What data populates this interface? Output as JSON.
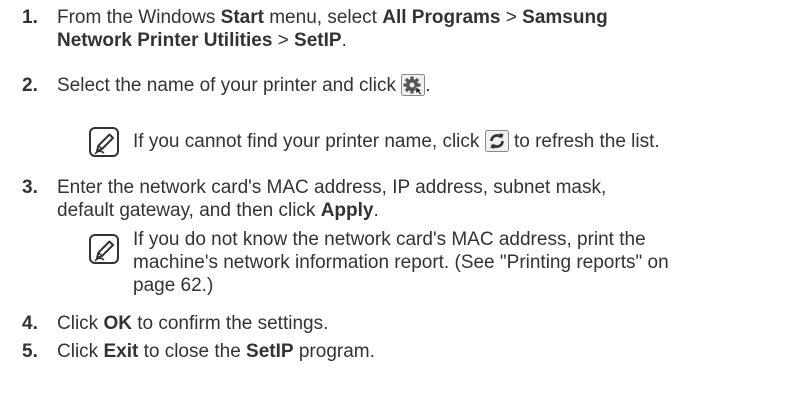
{
  "steps": [
    {
      "number": "1.",
      "line1": {
        "t1": "From the Windows ",
        "b1": "Start",
        "t2": " menu, select ",
        "b2": "All Programs",
        "t3": " > ",
        "b3": "Samsung"
      },
      "line2": {
        "b1": "Network Printer Utilities",
        "t1": " > ",
        "b2": "SetIP",
        "t2": "."
      }
    },
    {
      "number": "2.",
      "text": "Select the name of your printer and click",
      "after": ".",
      "icon": "settings-gear-icon"
    },
    {
      "number": "3.",
      "line1": "Enter the network card's MAC address, IP address, subnet mask,",
      "line2": {
        "t1": "default gateway, and then click ",
        "b1": "Apply",
        "t2": "."
      }
    },
    {
      "number": "4.",
      "t1": "Click ",
      "b1": "OK",
      "t2": " to confirm the settings."
    },
    {
      "number": "5.",
      "t1": "Click ",
      "b1": "Exit",
      "t2": " to close the ",
      "b2": "SetIP",
      "t3": " program."
    }
  ],
  "notes": [
    {
      "icon": "note-pencil-icon",
      "t1": "If you cannot find your printer name, click",
      "t2": "to refresh the list.",
      "inline_icon": "refresh-icon"
    },
    {
      "icon": "note-pencil-icon",
      "line1": "If you do not know the network card's MAC address, print the",
      "line2": "machine's network information report. (See \"Printing reports\" on",
      "line3": "page 62.)"
    }
  ],
  "colors": {
    "text": "#333333",
    "icon_border": "#555555",
    "icon_fill": "#e8e8e8"
  }
}
